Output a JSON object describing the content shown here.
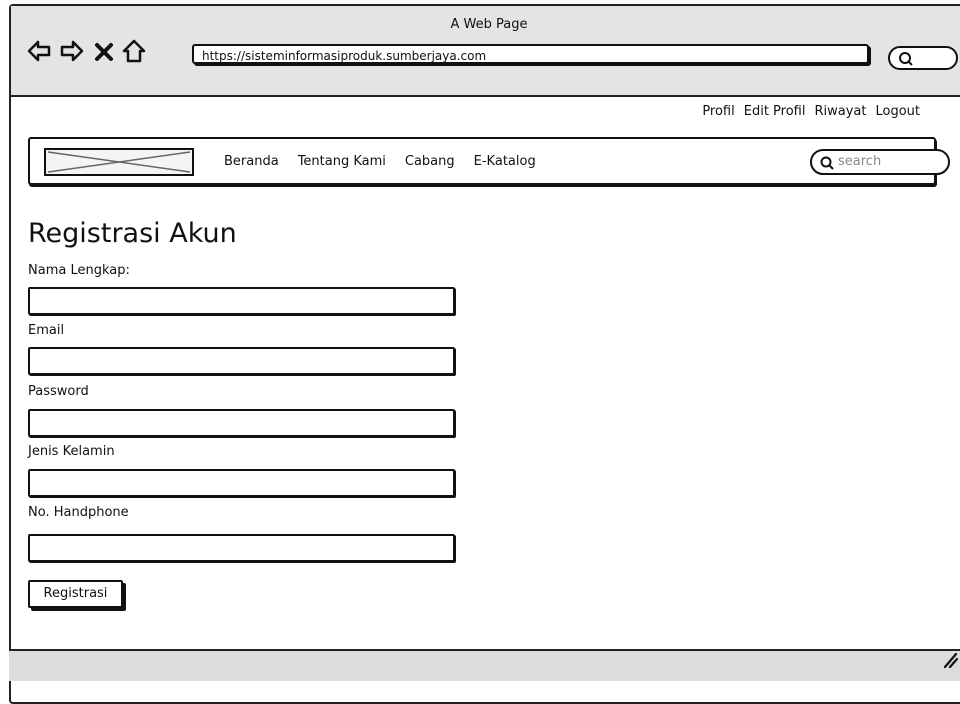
{
  "window": {
    "title": "A Web Page",
    "url": "https://sisteminformasiproduk.sumberjaya.com"
  },
  "toolbar_icons": [
    "back-icon",
    "forward-icon",
    "close-icon",
    "home-icon",
    "search-icon"
  ],
  "top_nav": [
    "Profil",
    "Edit Profil",
    "Riwayat",
    "Logout"
  ],
  "main_nav": [
    "Beranda",
    "Tentang Kami",
    "Cabang",
    "E-Katalog"
  ],
  "search": {
    "placeholder": "search"
  },
  "form": {
    "title": "Registrasi Akun",
    "fields": [
      {
        "label": "Nama Lengkap:",
        "value": ""
      },
      {
        "label": "Email",
        "value": ""
      },
      {
        "label": "Password",
        "value": ""
      },
      {
        "label": "Jenis Kelamin",
        "value": ""
      },
      {
        "label": "No. Handphone",
        "value": ""
      }
    ],
    "submit_label": "Registrasi"
  }
}
